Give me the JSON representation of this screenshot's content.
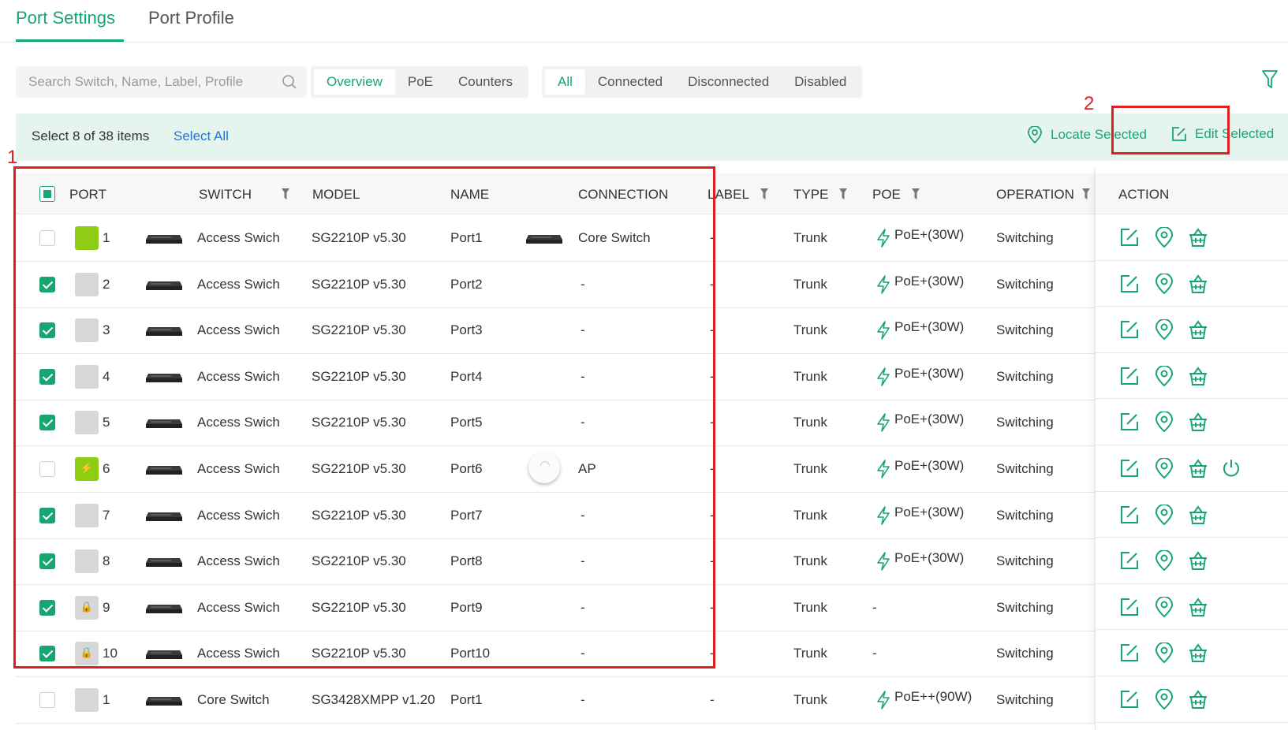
{
  "tabs": [
    {
      "label": "Port Settings",
      "active": true
    },
    {
      "label": "Port Profile",
      "active": false
    }
  ],
  "search": {
    "placeholder": "Search Switch, Name, Label, Profile",
    "value": ""
  },
  "view_options": [
    {
      "label": "Overview",
      "active": true
    },
    {
      "label": "PoE",
      "active": false
    },
    {
      "label": "Counters",
      "active": false
    }
  ],
  "status_options": [
    {
      "label": "All",
      "active": true
    },
    {
      "label": "Connected",
      "active": false
    },
    {
      "label": "Disconnected",
      "active": false
    },
    {
      "label": "Disabled",
      "active": false
    }
  ],
  "selection": {
    "count_text": "Select 8 of 38 items",
    "select_all": "Select All",
    "locate_selected": "Locate Selected",
    "edit_selected": "Edit Selected"
  },
  "annotations": {
    "box1": "1",
    "box2": "2"
  },
  "columns": {
    "port": "PORT",
    "switch": "SWITCH",
    "model": "MODEL",
    "name": "NAME",
    "connection": "CONNECTION",
    "label": "LABEL",
    "type": "TYPE",
    "poe": "POE",
    "operation": "OPERATION",
    "action": "ACTION"
  },
  "colors": {
    "accent": "#17a672",
    "link": "#1e74d9",
    "port_up": "#8fcd15",
    "port_down": "#d7d7d7",
    "annotation": "#e02020"
  },
  "rows": [
    {
      "checked": false,
      "port_state": "up",
      "port_glyph": "",
      "port": "1",
      "switch": "Access Swich",
      "model": "SG2210P v5.30",
      "name": "Port1",
      "conn_icon": "switch",
      "connection": "Core Switch",
      "label": "-",
      "type": "Trunk",
      "poe": "PoE+(30W)",
      "poe_icon": true,
      "operation": "Switching",
      "power": false
    },
    {
      "checked": true,
      "port_state": "down",
      "port_glyph": "",
      "port": "2",
      "switch": "Access Swich",
      "model": "SG2210P v5.30",
      "name": "Port2",
      "conn_icon": "",
      "connection": "-",
      "label": "-",
      "type": "Trunk",
      "poe": "PoE+(30W)",
      "poe_icon": true,
      "operation": "Switching",
      "power": false
    },
    {
      "checked": true,
      "port_state": "down",
      "port_glyph": "",
      "port": "3",
      "switch": "Access Swich",
      "model": "SG2210P v5.30",
      "name": "Port3",
      "conn_icon": "",
      "connection": "-",
      "label": "-",
      "type": "Trunk",
      "poe": "PoE+(30W)",
      "poe_icon": true,
      "operation": "Switching",
      "power": false
    },
    {
      "checked": true,
      "port_state": "down",
      "port_glyph": "",
      "port": "4",
      "switch": "Access Swich",
      "model": "SG2210P v5.30",
      "name": "Port4",
      "conn_icon": "",
      "connection": "-",
      "label": "-",
      "type": "Trunk",
      "poe": "PoE+(30W)",
      "poe_icon": true,
      "operation": "Switching",
      "power": false
    },
    {
      "checked": true,
      "port_state": "down",
      "port_glyph": "",
      "port": "5",
      "switch": "Access Swich",
      "model": "SG2210P v5.30",
      "name": "Port5",
      "conn_icon": "",
      "connection": "-",
      "label": "-",
      "type": "Trunk",
      "poe": "PoE+(30W)",
      "poe_icon": true,
      "operation": "Switching",
      "power": false
    },
    {
      "checked": false,
      "port_state": "up",
      "port_glyph": "⚡",
      "port": "6",
      "switch": "Access Swich",
      "model": "SG2210P v5.30",
      "name": "Port6",
      "conn_icon": "ap",
      "connection": "AP",
      "label": "-",
      "type": "Trunk",
      "poe": "PoE+(30W)",
      "poe_icon": true,
      "operation": "Switching",
      "power": true
    },
    {
      "checked": true,
      "port_state": "down",
      "port_glyph": "",
      "port": "7",
      "switch": "Access Swich",
      "model": "SG2210P v5.30",
      "name": "Port7",
      "conn_icon": "",
      "connection": "-",
      "label": "-",
      "type": "Trunk",
      "poe": "PoE+(30W)",
      "poe_icon": true,
      "operation": "Switching",
      "power": false
    },
    {
      "checked": true,
      "port_state": "down",
      "port_glyph": "",
      "port": "8",
      "switch": "Access Swich",
      "model": "SG2210P v5.30",
      "name": "Port8",
      "conn_icon": "",
      "connection": "-",
      "label": "-",
      "type": "Trunk",
      "poe": "PoE+(30W)",
      "poe_icon": true,
      "operation": "Switching",
      "power": false
    },
    {
      "checked": true,
      "port_state": "down",
      "port_glyph": "🔒",
      "port": "9",
      "switch": "Access Swich",
      "model": "SG2210P v5.30",
      "name": "Port9",
      "conn_icon": "",
      "connection": "-",
      "label": "-",
      "type": "Trunk",
      "poe": "-",
      "poe_icon": false,
      "operation": "Switching",
      "power": false
    },
    {
      "checked": true,
      "port_state": "down",
      "port_glyph": "🔒",
      "port": "10",
      "switch": "Access Swich",
      "model": "SG2210P v5.30",
      "name": "Port10",
      "conn_icon": "",
      "connection": "-",
      "label": "-",
      "type": "Trunk",
      "poe": "-",
      "poe_icon": false,
      "operation": "Switching",
      "power": false
    },
    {
      "checked": false,
      "port_state": "down",
      "port_glyph": "",
      "port": "1",
      "switch": "Core Switch",
      "model": "SG3428XMPP v1.20",
      "name": "Port1",
      "conn_icon": "",
      "connection": "-",
      "label": "-",
      "type": "Trunk",
      "poe": "PoE++(90W)",
      "poe_icon": true,
      "operation": "Switching",
      "power": false
    }
  ]
}
